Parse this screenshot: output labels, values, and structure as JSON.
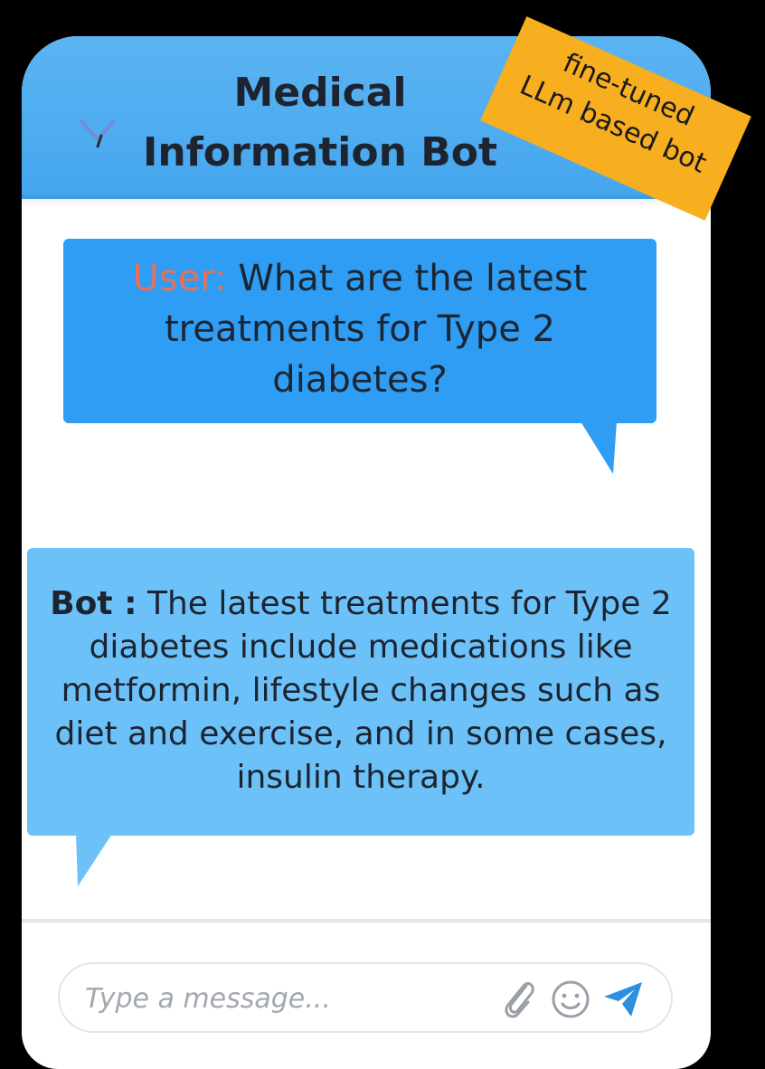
{
  "header": {
    "title": "Medical Information Bot"
  },
  "badge": {
    "line1": "fine-tuned",
    "line2": "LLm based bot",
    "color": "#f7ae1f"
  },
  "messages": [
    {
      "speaker": "User:",
      "text": "What are the latest treatments for Type 2 diabetes?",
      "speaker_color": "#e8705b",
      "bubble_color": "#2e9df3"
    },
    {
      "speaker": "Bot :",
      "text": "The latest treatments for Type 2 diabetes include medications like metformin, lifestyle changes such as diet and exercise, and in some cases, insulin therapy.",
      "bubble_color": "#6cc2f8"
    }
  ],
  "composer": {
    "placeholder": "Type a message...",
    "value": ""
  },
  "icons": {
    "collapse": "chevron-down-icon",
    "attach": "paperclip-icon",
    "emoji": "smiley-icon",
    "send": "send-icon"
  },
  "colors": {
    "header": "#45a6ee",
    "send": "#2e8fe0"
  }
}
